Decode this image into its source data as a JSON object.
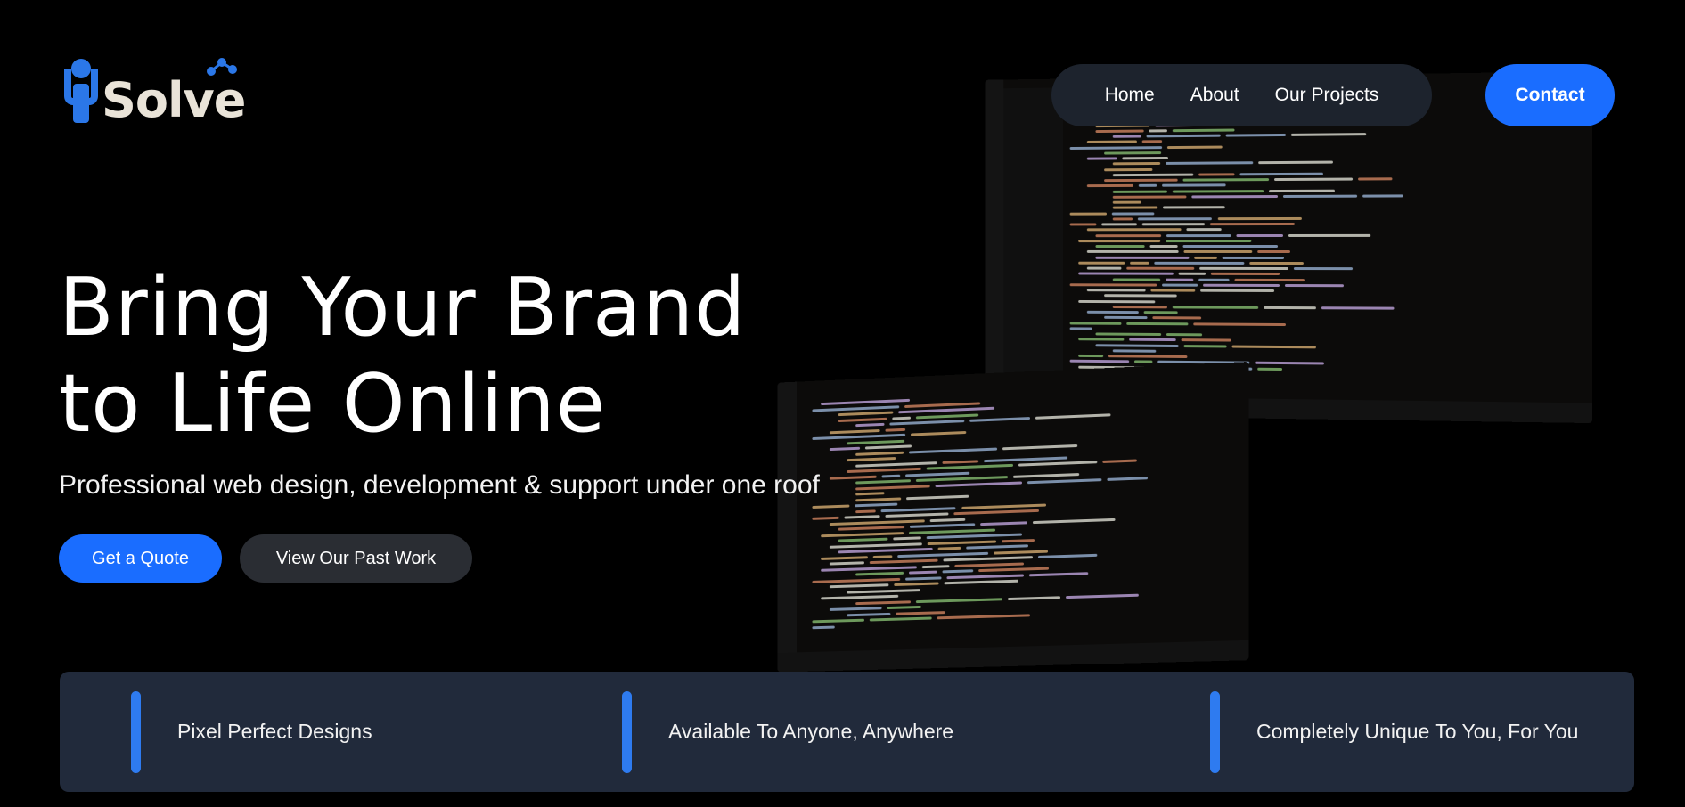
{
  "brand": {
    "logo_text": "Solve",
    "logo_initial": "i",
    "colors": {
      "primary": "#1a6dff",
      "logo_blue": "#2b77e8",
      "logo_text": "#e9e3d8",
      "panel": "#212a3b",
      "nav_bg": "#1d232d"
    }
  },
  "nav": {
    "items": [
      {
        "label": "Home"
      },
      {
        "label": "About"
      },
      {
        "label": "Our Projects"
      }
    ],
    "contact_label": "Contact"
  },
  "hero": {
    "title_line1": "Bring Your Brand",
    "title_line2": "to Life Online",
    "subtitle": "Professional web design, development & support under one roof",
    "primary_cta": "Get a Quote",
    "secondary_cta": "View Our Past Work"
  },
  "features": [
    {
      "label": "Pixel Perfect Designs"
    },
    {
      "label": "Available To Anyone, Anywhere"
    },
    {
      "label": "Completely Unique To You, For You"
    }
  ],
  "background": {
    "image_description_icon": "code-monitors-photo"
  }
}
